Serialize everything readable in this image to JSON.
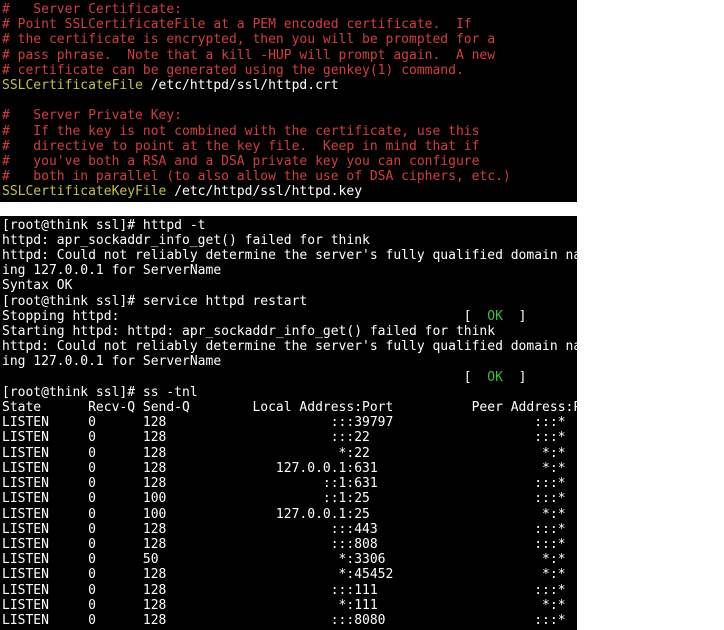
{
  "config": {
    "lines": [
      {
        "segs": [
          {
            "t": "#   Server Certificate:",
            "c": "c-red"
          }
        ]
      },
      {
        "segs": [
          {
            "t": "# Point SSLCertificateFile at a PEM encoded certificate.  If",
            "c": "c-red"
          }
        ]
      },
      {
        "segs": [
          {
            "t": "# the certificate is encrypted, then you will be prompted for a",
            "c": "c-red"
          }
        ]
      },
      {
        "segs": [
          {
            "t": "# pass phrase.  Note that a kill -HUP will prompt again.  A new",
            "c": "c-red"
          }
        ]
      },
      {
        "segs": [
          {
            "t": "# certificate can be generated using the genkey(1) command.",
            "c": "c-red"
          }
        ]
      },
      {
        "segs": [
          {
            "t": "SSLCertificateFile",
            "c": "c-yellow"
          },
          {
            "t": " /etc/httpd/ssl/httpd.crt"
          }
        ]
      },
      {
        "segs": [
          {
            "t": " "
          }
        ]
      },
      {
        "segs": [
          {
            "t": "#   Server Private Key:",
            "c": "c-red"
          }
        ]
      },
      {
        "segs": [
          {
            "t": "#   If the key is not combined with the certificate, use this",
            "c": "c-red"
          }
        ]
      },
      {
        "segs": [
          {
            "t": "#   directive to point at the key file.  Keep in mind that if",
            "c": "c-red"
          }
        ]
      },
      {
        "segs": [
          {
            "t": "#   you've both a RSA and a DSA private key you can configure",
            "c": "c-red"
          }
        ]
      },
      {
        "segs": [
          {
            "t": "#   both in parallel (to also allow the use of DSA ciphers, etc.)",
            "c": "c-red"
          }
        ]
      },
      {
        "segs": [
          {
            "t": "SSLCertificateKeyFile",
            "c": "c-yellow"
          },
          {
            "t": " /etc/httpd/ssl/httpd.key"
          }
        ]
      }
    ]
  },
  "terminal": {
    "lines": [
      {
        "segs": [
          {
            "t": "[root@think ssl]# httpd -t"
          }
        ]
      },
      {
        "segs": [
          {
            "t": "httpd: apr_sockaddr_info_get() failed for think"
          }
        ]
      },
      {
        "segs": [
          {
            "t": "httpd: Could not reliably determine the server's fully qualified domain name, us"
          }
        ]
      },
      {
        "segs": [
          {
            "t": "ing 127.0.0.1 for ServerName"
          }
        ]
      },
      {
        "segs": [
          {
            "t": "Syntax OK"
          }
        ]
      },
      {
        "segs": [
          {
            "t": "[root@think ssl]# service httpd restart"
          }
        ]
      },
      {
        "segs": [
          {
            "t": "Stopping httpd:                                            [  "
          },
          {
            "t": "OK",
            "c": "c-green"
          },
          {
            "t": "  ]"
          }
        ]
      },
      {
        "segs": [
          {
            "t": "Starting httpd: httpd: apr_sockaddr_info_get() failed for think"
          }
        ]
      },
      {
        "segs": [
          {
            "t": "httpd: Could not reliably determine the server's fully qualified domain name, us"
          }
        ]
      },
      {
        "segs": [
          {
            "t": "ing 127.0.0.1 for ServerName"
          }
        ]
      },
      {
        "segs": [
          {
            "t": "                                                           [  "
          },
          {
            "t": "OK",
            "c": "c-green"
          },
          {
            "t": "  ]"
          }
        ]
      },
      {
        "segs": [
          {
            "t": "[root@think ssl]# ss -tnl"
          }
        ]
      },
      {
        "segs": [
          {
            "t": "State      Recv-Q Send-Q        Local Address:Port          Peer Address:Port "
          }
        ]
      },
      {
        "segs": [
          {
            "t": "LISTEN     0      128                     :::39797                  :::*     "
          }
        ]
      },
      {
        "segs": [
          {
            "t": "LISTEN     0      128                     :::22                     :::*     "
          }
        ]
      },
      {
        "segs": [
          {
            "t": "LISTEN     0      128                      *:22                      *:*     "
          }
        ]
      },
      {
        "segs": [
          {
            "t": "LISTEN     0      128              127.0.0.1:631                     *:*     "
          }
        ]
      },
      {
        "segs": [
          {
            "t": "LISTEN     0      128                    ::1:631                    :::*     "
          }
        ]
      },
      {
        "segs": [
          {
            "t": "LISTEN     0      100                    ::1:25                     :::*     "
          }
        ]
      },
      {
        "segs": [
          {
            "t": "LISTEN     0      100              127.0.0.1:25                      *:*     "
          }
        ]
      },
      {
        "segs": [
          {
            "t": "LISTEN     0      128                     :::443                    :::*     "
          }
        ]
      },
      {
        "segs": [
          {
            "t": "LISTEN     0      128                     :::808                    :::*     "
          }
        ]
      },
      {
        "segs": [
          {
            "t": "LISTEN     0      50                       *:3306                    *:*     "
          }
        ]
      },
      {
        "segs": [
          {
            "t": "LISTEN     0      128                      *:45452                   *:*     "
          }
        ]
      },
      {
        "segs": [
          {
            "t": "LISTEN     0      128                     :::111                    :::*     "
          }
        ]
      },
      {
        "segs": [
          {
            "t": "LISTEN     0      128                      *:111                     *:*     "
          }
        ]
      },
      {
        "segs": [
          {
            "t": "LISTEN     0      128                     :::8080                   :::*     "
          }
        ]
      }
    ]
  }
}
